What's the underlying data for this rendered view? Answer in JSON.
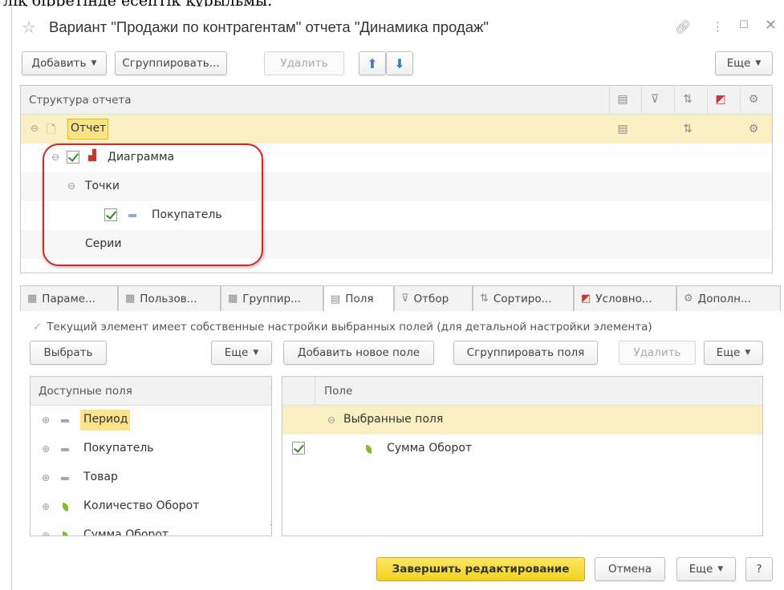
{
  "top_caption": "ліқ бірретінде есептік құрыльмы.",
  "window": {
    "title": "Вариант \"Продажи по контрагентам\" отчета \"Динамика продаж\"",
    "icons": [
      "star-icon",
      "link-icon",
      "more-vertical-icon",
      "maximize-icon",
      "close-icon"
    ]
  },
  "toolbar": {
    "add_label": "Добавить",
    "group_label": "Сгруппировать...",
    "delete_label": "Удалить",
    "more_label": "Еще"
  },
  "structure": {
    "header": "Структура отчета",
    "column_icons": [
      "groupings-icon",
      "filter-icon",
      "order-icon",
      "conditional-format-icon",
      "extra-settings-icon"
    ],
    "rows": [
      {
        "label": "Отчет"
      },
      {
        "label": "Диаграмма"
      },
      {
        "label": "Точки"
      },
      {
        "label": "Покупатель"
      },
      {
        "label": "Серии"
      }
    ]
  },
  "tabs": [
    {
      "label": "Параме..."
    },
    {
      "label": "Пользов..."
    },
    {
      "label": "Группир..."
    },
    {
      "label": "Поля"
    },
    {
      "label": "Отбор"
    },
    {
      "label": "Сортиро..."
    },
    {
      "label": "Условно..."
    },
    {
      "label": "Дополн..."
    }
  ],
  "own_settings_text": "Текущий элемент имеет собственные настройки выбранных полей (для детальной настройки элемента)",
  "fields_toolbar": {
    "select_label": "Выбрать",
    "more_left_label": "Еще",
    "add_field_label": "Добавить новое поле",
    "group_fields_label": "Сгруппировать поля",
    "delete_label": "Удалить",
    "more_right_label": "Еще"
  },
  "available_fields": {
    "header": "Доступные поля",
    "items": [
      {
        "label": "Период"
      },
      {
        "label": "Покупатель"
      },
      {
        "label": "Товар"
      },
      {
        "label": "Количество Оборот"
      },
      {
        "label": "Сумма Оборот"
      }
    ]
  },
  "selected_fields": {
    "header": "Поле",
    "group_label": "Выбранные поля",
    "items": [
      {
        "label": "Сумма Оборот"
      }
    ]
  },
  "footer": {
    "finish_label": "Завершить редактирование",
    "cancel_label": "Отмена",
    "more_label": "Еще",
    "help_label": "?"
  },
  "colors": {
    "selection": "#fbf0c3",
    "primary_button": "#f2d21e",
    "annotation": "#e02020",
    "check": "#2e8b2e"
  }
}
